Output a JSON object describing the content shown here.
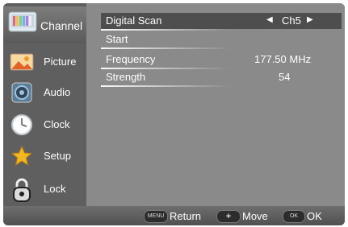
{
  "sidebar": {
    "items": [
      {
        "label": "Channel",
        "icon": "tv-icon"
      },
      {
        "label": "Picture",
        "icon": "picture-icon"
      },
      {
        "label": "Audio",
        "icon": "speaker-icon"
      },
      {
        "label": "Clock",
        "icon": "clock-icon"
      },
      {
        "label": "Setup",
        "icon": "star-icon"
      },
      {
        "label": "Lock",
        "icon": "padlock-icon"
      }
    ]
  },
  "menu": {
    "digital_scan": {
      "label": "Digital Scan",
      "value": "Ch5"
    },
    "start": {
      "label": "Start"
    },
    "frequency": {
      "label": "Frequency",
      "value": "177.50 MHz"
    },
    "strength": {
      "label": "Strength",
      "value": "54"
    }
  },
  "footer": {
    "return": {
      "key": "MENU",
      "label": "Return"
    },
    "move": {
      "key": "+",
      "label": "Move"
    },
    "ok": {
      "key": "OK",
      "label": "OK"
    }
  },
  "colors": {
    "background": "#8a8a8a",
    "sidebar": "#5f5f5f",
    "selected_row": "#4e4e4e"
  }
}
